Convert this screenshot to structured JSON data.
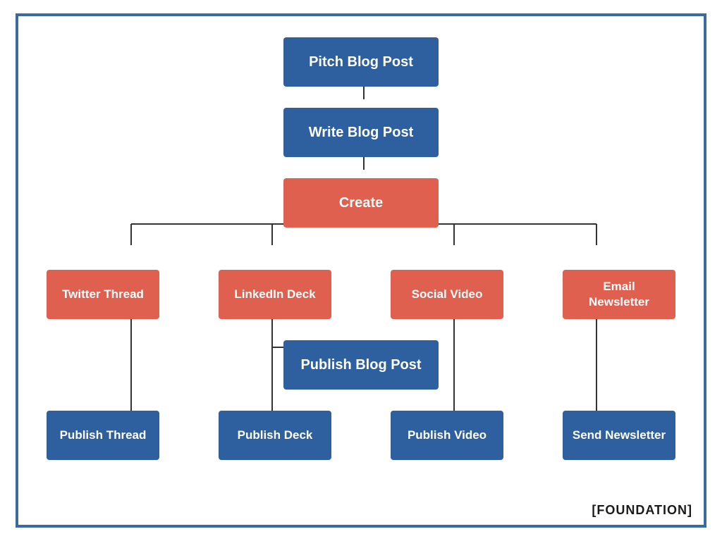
{
  "nodes": {
    "pitch": "Pitch Blog Post",
    "write": "Write Blog Post",
    "create": "Create",
    "twitter": "Twitter Thread",
    "linkedin": "LinkedIn Deck",
    "social": "Social Video",
    "email": "Email Newsletter",
    "publishBlog": "Publish Blog Post",
    "publishThread": "Publish Thread",
    "publishDeck": "Publish Deck",
    "publishVideo": "Publish Video",
    "sendNewsletter": "Send Newsletter"
  },
  "brand": {
    "name": "[FOUNDATION]"
  },
  "colors": {
    "blue": "#2e5f9e",
    "red": "#e06050",
    "border": "#3a6b9e",
    "white": "#ffffff",
    "black": "#1a1a1a"
  }
}
